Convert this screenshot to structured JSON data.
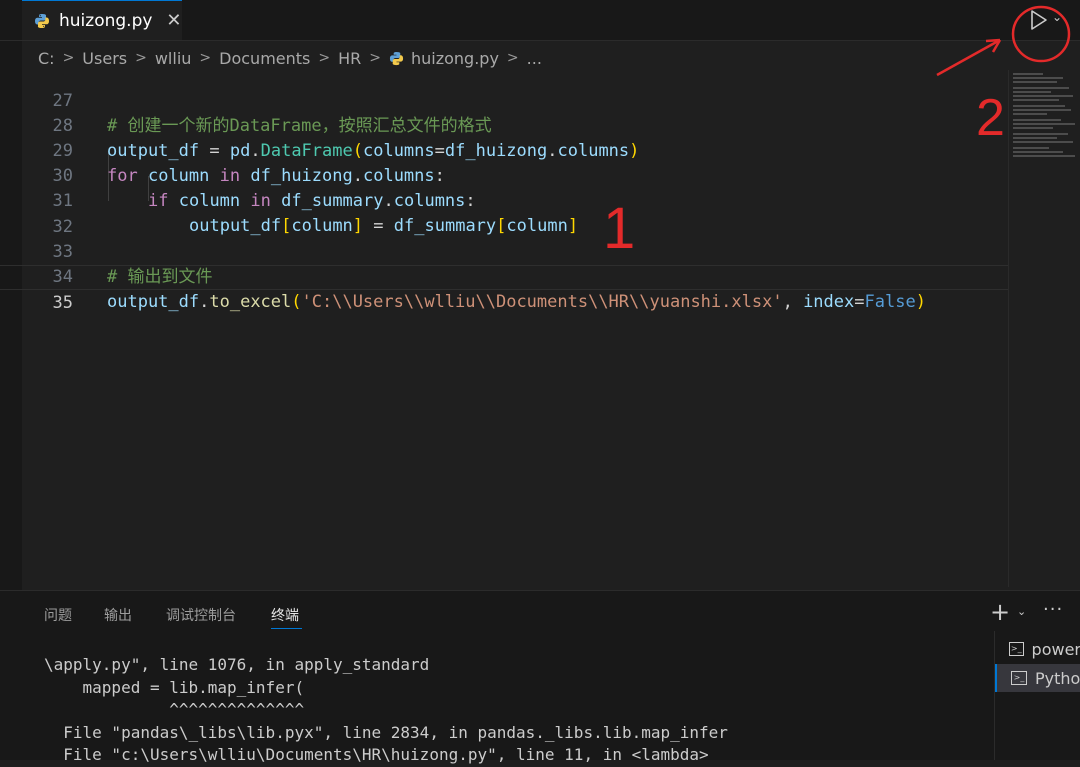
{
  "tab": {
    "title": "huizong.py",
    "close": "✕"
  },
  "breadcrumb": [
    "C:",
    "Users",
    "wlliu",
    "Documents",
    "HR",
    "huizong.py",
    "..."
  ],
  "editor": {
    "lines": [
      {
        "n": "27",
        "text": "# 创建一个新的DataFrame，按照汇总文件的格式"
      },
      {
        "n": "28",
        "text": "output_df = pd.DataFrame(columns=df_huizong.columns)"
      },
      {
        "n": "29",
        "text": "for column in df_huizong.columns:"
      },
      {
        "n": "30",
        "text": "if column in df_summary.columns:"
      },
      {
        "n": "31",
        "text": "output_df[column] = df_summary[column]"
      },
      {
        "n": "32",
        "text": ""
      },
      {
        "n": "33",
        "text": "# 输出到文件"
      },
      {
        "n": "34",
        "text": "output_df.to_excel('C:\\\\Users\\\\wlliu\\\\Documents\\\\HR\\\\yuanshi.xlsx', index=False)"
      },
      {
        "n": "35",
        "text": ""
      }
    ]
  },
  "annotations": {
    "one": "1",
    "two": "2"
  },
  "panel": {
    "tabs": [
      "问题",
      "输出",
      "调试控制台",
      "终端"
    ],
    "active_tab": "终端",
    "plus": "+",
    "more": "···"
  },
  "terminal": {
    "lines": [
      "\\apply.py\", line 1076, in apply_standard",
      "    mapped = lib.map_infer(",
      "             ^^^^^^^^^^^^^^",
      "  File \"pandas\\_libs\\lib.pyx\", line 2834, in pandas._libs.lib.map_infer",
      "  File \"c:\\Users\\wlliu\\Documents\\HR\\huizong.py\", line 11, in <lambda>"
    ],
    "sessions": [
      "power",
      "Pytho"
    ]
  },
  "colors": {
    "accent": "#0078d4",
    "annotation": "#e32a2a"
  },
  "icons": {
    "run": "play-icon",
    "file": "python-file-icon",
    "terminal": "terminal-icon"
  }
}
